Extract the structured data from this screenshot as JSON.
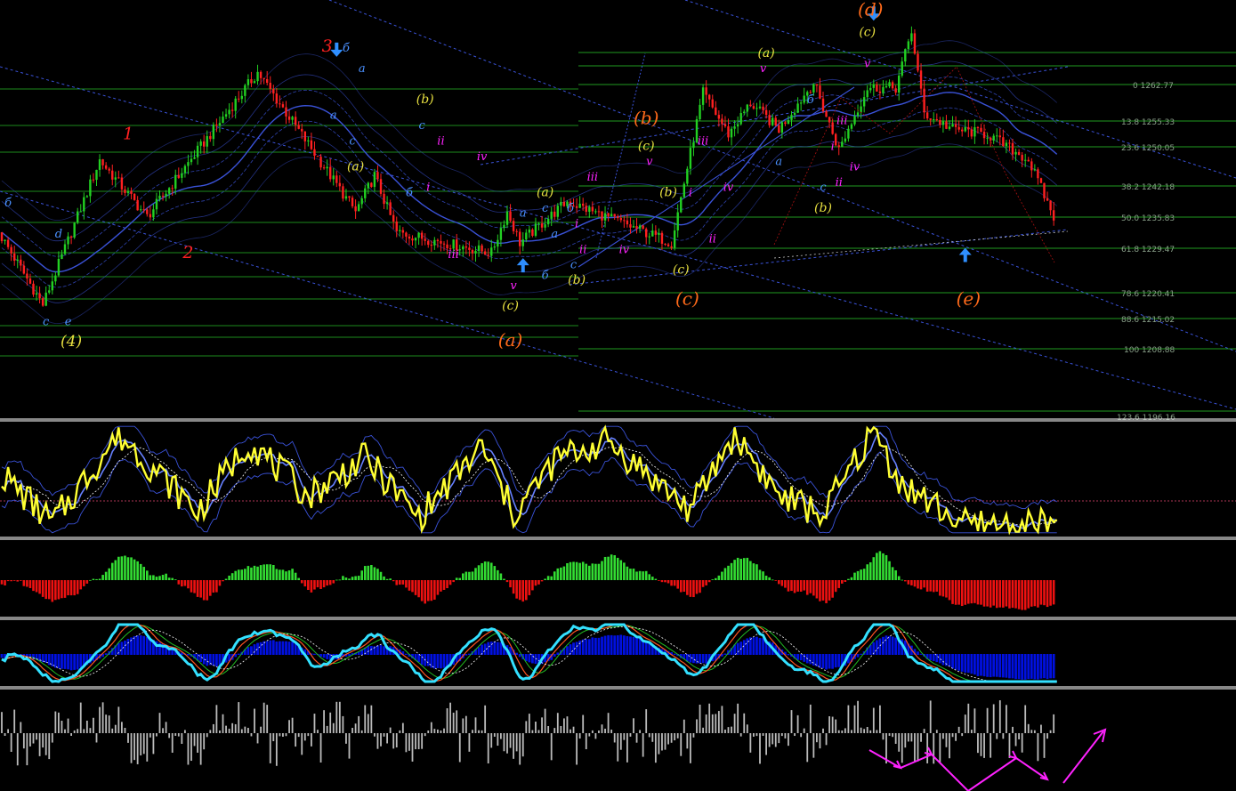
{
  "colors": {
    "background": "#000000",
    "bull_candle": "#22d022",
    "bear_candle": "#ff2020",
    "fib_line": "#1f9a1f",
    "channel_line": "#3a52d8",
    "yellow_osc": "#ffff33",
    "cyan_osc": "#33e0ff",
    "hist_green": "#33dd33",
    "hist_red": "#ee1111",
    "hist_grey": "#bbbbbb",
    "blue_fill": "#0010e0",
    "magenta": "#ff22ff",
    "arrow_blue": "#2f8fff",
    "pane_separator": "#d8d8d8"
  },
  "fib_levels": [
    {
      "text": "0 1262.77"
    },
    {
      "text": "13.8 1255.33"
    },
    {
      "text": "23.6 1250.05"
    },
    {
      "text": "38.2 1242.18"
    },
    {
      "text": "50.0 1235.83"
    },
    {
      "text": "61.8 1229.47"
    },
    {
      "text": "78.6 1220.41"
    },
    {
      "text": "88.6 1215.02"
    },
    {
      "text": "100 1208.88"
    },
    {
      "text": "123.6 1196.16"
    }
  ],
  "chart_data": {
    "type": "candlestick",
    "title": "",
    "price_range": [
      1193,
      1274
    ],
    "price_path": [
      {
        "bar": 0,
        "price": 1229
      },
      {
        "bar": 14,
        "price": 1215
      },
      {
        "bar": 32,
        "price": 1243
      },
      {
        "bar": 47,
        "price": 1232
      },
      {
        "bar": 82,
        "price": 1260
      },
      {
        "bar": 113,
        "price": 1233
      },
      {
        "bar": 119,
        "price": 1240
      },
      {
        "bar": 126,
        "price": 1229
      },
      {
        "bar": 156,
        "price": 1225
      },
      {
        "bar": 161,
        "price": 1233
      },
      {
        "bar": 165,
        "price": 1227
      },
      {
        "bar": 180,
        "price": 1235
      },
      {
        "bar": 213,
        "price": 1227
      },
      {
        "bar": 223,
        "price": 1256
      },
      {
        "bar": 231,
        "price": 1248
      },
      {
        "bar": 238,
        "price": 1254
      },
      {
        "bar": 247,
        "price": 1249
      },
      {
        "bar": 258,
        "price": 1258
      },
      {
        "bar": 266,
        "price": 1245
      },
      {
        "bar": 275,
        "price": 1257
      },
      {
        "bar": 284,
        "price": 1257
      },
      {
        "bar": 289,
        "price": 1268
      },
      {
        "bar": 293,
        "price": 1252
      },
      {
        "bar": 302,
        "price": 1249
      },
      {
        "bar": 313,
        "price": 1248
      },
      {
        "bar": 326,
        "price": 1243
      },
      {
        "bar": 334,
        "price": 1232
      }
    ],
    "wave_labels": [
      {
        "text": "б",
        "color": "#4a90ff",
        "bar": 2,
        "price": 1234,
        "size": 13
      },
      {
        "text": "d",
        "color": "#4a90ff",
        "bar": 18,
        "price": 1228,
        "size": 13
      },
      {
        "text": "c",
        "color": "#4a90ff",
        "bar": 14,
        "price": 1211,
        "size": 13
      },
      {
        "text": "e",
        "color": "#4a90ff",
        "bar": 21,
        "price": 1211,
        "size": 13
      },
      {
        "text": "(4)",
        "color": "#e8e040",
        "bar": 22,
        "price": 1207,
        "size": 17
      },
      {
        "text": "1",
        "color": "#ff2020",
        "bar": 40,
        "price": 1247,
        "size": 19
      },
      {
        "text": "2",
        "color": "#ff2020",
        "bar": 59,
        "price": 1224,
        "size": 19
      },
      {
        "text": "3",
        "color": "#ff2020",
        "bar": 103,
        "price": 1264,
        "size": 19
      },
      {
        "text": "б",
        "color": "#4a90ff",
        "bar": 109,
        "price": 1264,
        "size": 13
      },
      {
        "text": "a",
        "color": "#4a90ff",
        "bar": 114,
        "price": 1260,
        "size": 13
      },
      {
        "text": "a",
        "color": "#4a90ff",
        "bar": 105,
        "price": 1251,
        "size": 13
      },
      {
        "text": "c",
        "color": "#4a90ff",
        "bar": 111,
        "price": 1246,
        "size": 13
      },
      {
        "text": "(a)",
        "color": "#e8e040",
        "bar": 112,
        "price": 1241,
        "size": 14
      },
      {
        "text": "(b)",
        "color": "#e8e040",
        "bar": 134,
        "price": 1254,
        "size": 14
      },
      {
        "text": "c",
        "color": "#4a90ff",
        "bar": 133,
        "price": 1249,
        "size": 13
      },
      {
        "text": "ii",
        "color": "#ff22ff",
        "bar": 139,
        "price": 1246,
        "size": 13
      },
      {
        "text": "б",
        "color": "#4a90ff",
        "bar": 129,
        "price": 1236,
        "size": 13
      },
      {
        "text": "i",
        "color": "#ff22ff",
        "bar": 135,
        "price": 1237,
        "size": 13
      },
      {
        "text": "iv",
        "color": "#ff22ff",
        "bar": 152,
        "price": 1243,
        "size": 13
      },
      {
        "text": "iii",
        "color": "#ff22ff",
        "bar": 143,
        "price": 1224,
        "size": 13
      },
      {
        "text": "v",
        "color": "#ff22ff",
        "bar": 162,
        "price": 1218,
        "size": 13
      },
      {
        "text": "(c)",
        "color": "#e8e040",
        "bar": 161,
        "price": 1214,
        "size": 14
      },
      {
        "text": "(a)",
        "color": "#ff6a1a",
        "bar": 161,
        "price": 1207,
        "size": 20
      },
      {
        "text": "a",
        "color": "#4a90ff",
        "bar": 165,
        "price": 1232,
        "size": 13
      },
      {
        "text": "c",
        "color": "#4a90ff",
        "bar": 172,
        "price": 1233,
        "size": 13
      },
      {
        "text": "(a)",
        "color": "#e8e040",
        "bar": 172,
        "price": 1236,
        "size": 14
      },
      {
        "text": "б",
        "color": "#4a90ff",
        "bar": 172,
        "price": 1220,
        "size": 13
      },
      {
        "text": "a",
        "color": "#4a90ff",
        "bar": 175,
        "price": 1228,
        "size": 13
      },
      {
        "text": "б",
        "color": "#4a90ff",
        "bar": 180,
        "price": 1233,
        "size": 13
      },
      {
        "text": "i",
        "color": "#ff22ff",
        "bar": 182,
        "price": 1230,
        "size": 13
      },
      {
        "text": "ii",
        "color": "#ff22ff",
        "bar": 184,
        "price": 1225,
        "size": 13
      },
      {
        "text": "c",
        "color": "#4a90ff",
        "bar": 181,
        "price": 1222,
        "size": 13
      },
      {
        "text": "(b)",
        "color": "#e8e040",
        "bar": 182,
        "price": 1219,
        "size": 14
      },
      {
        "text": "iii",
        "color": "#ff22ff",
        "bar": 187,
        "price": 1239,
        "size": 13
      },
      {
        "text": "iv",
        "color": "#ff22ff",
        "bar": 197,
        "price": 1225,
        "size": 13
      },
      {
        "text": "v",
        "color": "#ff22ff",
        "bar": 205,
        "price": 1242,
        "size": 13
      },
      {
        "text": "(b)",
        "color": "#e8e040",
        "bar": 211,
        "price": 1236,
        "size": 14
      },
      {
        "text": "i",
        "color": "#ff22ff",
        "bar": 218,
        "price": 1236,
        "size": 13
      },
      {
        "text": "ii",
        "color": "#ff22ff",
        "bar": 225,
        "price": 1227,
        "size": 13
      },
      {
        "text": "(c)",
        "color": "#e8e040",
        "bar": 215,
        "price": 1221,
        "size": 14
      },
      {
        "text": "(c)",
        "color": "#ff6a1a",
        "bar": 217,
        "price": 1215,
        "size": 20
      },
      {
        "text": "(b)",
        "color": "#ff6a1a",
        "bar": 204,
        "price": 1250,
        "size": 20
      },
      {
        "text": "(c)",
        "color": "#e8e040",
        "bar": 204,
        "price": 1245,
        "size": 14
      },
      {
        "text": "iii",
        "color": "#ff22ff",
        "bar": 222,
        "price": 1246,
        "size": 13
      },
      {
        "text": "iv",
        "color": "#ff22ff",
        "bar": 230,
        "price": 1237,
        "size": 13
      },
      {
        "text": "(a)",
        "color": "#e8e040",
        "bar": 242,
        "price": 1263,
        "size": 14
      },
      {
        "text": "v",
        "color": "#ff22ff",
        "bar": 241,
        "price": 1260,
        "size": 13
      },
      {
        "text": "a",
        "color": "#4a90ff",
        "bar": 246,
        "price": 1242,
        "size": 13
      },
      {
        "text": "б",
        "color": "#4a90ff",
        "bar": 256,
        "price": 1254,
        "size": 13
      },
      {
        "text": "c",
        "color": "#4a90ff",
        "bar": 260,
        "price": 1237,
        "size": 13
      },
      {
        "text": "(b)",
        "color": "#e8e040",
        "bar": 260,
        "price": 1233,
        "size": 14
      },
      {
        "text": "i",
        "color": "#ff22ff",
        "bar": 263,
        "price": 1245,
        "size": 13
      },
      {
        "text": "ii",
        "color": "#ff22ff",
        "bar": 265,
        "price": 1238,
        "size": 13
      },
      {
        "text": "iii",
        "color": "#ff22ff",
        "bar": 266,
        "price": 1250,
        "size": 13
      },
      {
        "text": "iv",
        "color": "#ff22ff",
        "bar": 270,
        "price": 1241,
        "size": 13
      },
      {
        "text": "v",
        "color": "#ff22ff",
        "bar": 274,
        "price": 1261,
        "size": 13
      },
      {
        "text": "(c)",
        "color": "#e8e040",
        "bar": 274,
        "price": 1267,
        "size": 14
      },
      {
        "text": "(d)",
        "color": "#ff6a1a",
        "bar": 275,
        "price": 1271,
        "size": 20
      },
      {
        "text": "(e)",
        "color": "#ff6a1a",
        "bar": 306,
        "price": 1215,
        "size": 20
      }
    ],
    "arrows": [
      {
        "dir": "down",
        "bar": 106,
        "price": 1263
      },
      {
        "dir": "up",
        "bar": 165,
        "price": 1224
      },
      {
        "dir": "down",
        "bar": 276,
        "price": 1270
      },
      {
        "dir": "up",
        "bar": 305,
        "price": 1226
      }
    ]
  },
  "oscillator_hint": [
    {
      "bar": 0,
      "value": 55
    },
    {
      "bar": 16,
      "value": 10
    },
    {
      "bar": 37,
      "value": 92
    },
    {
      "bar": 62,
      "value": 20
    },
    {
      "bar": 78,
      "value": 85
    },
    {
      "bar": 97,
      "value": 35
    },
    {
      "bar": 115,
      "value": 70
    },
    {
      "bar": 132,
      "value": 15
    },
    {
      "bar": 152,
      "value": 80
    },
    {
      "bar": 162,
      "value": 18
    },
    {
      "bar": 176,
      "value": 70
    },
    {
      "bar": 192,
      "value": 85
    },
    {
      "bar": 218,
      "value": 22
    },
    {
      "bar": 232,
      "value": 93
    },
    {
      "bar": 246,
      "value": 35
    },
    {
      "bar": 260,
      "value": 18
    },
    {
      "bar": 276,
      "value": 95
    },
    {
      "bar": 285,
      "value": 45
    },
    {
      "bar": 305,
      "value": 8
    }
  ]
}
